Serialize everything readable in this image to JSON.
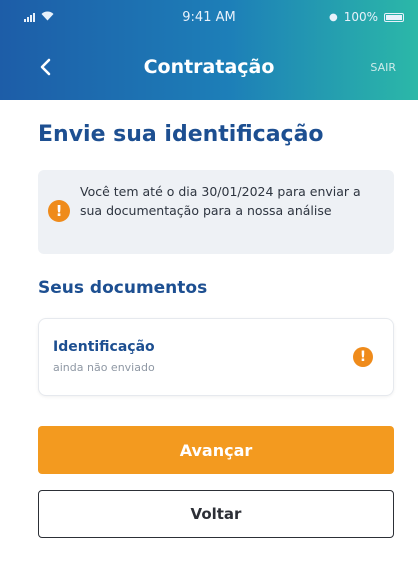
{
  "status_bar": {
    "time": "9:41 AM",
    "battery": "100%",
    "signal_icon": "signal-icon",
    "wifi_icon": "wifi-icon",
    "battery_icon": "battery-icon",
    "alarm_icon": "alarm-icon"
  },
  "nav": {
    "title": "Contratação",
    "exit_label": "SAIR",
    "back_icon": "chevron-left-icon"
  },
  "page": {
    "title": "Envie sua identificação"
  },
  "notice": {
    "text": "Você tem até o dia 30/01/2024 para enviar a sua documentação para a nossa análise",
    "icon": "warning-icon",
    "icon_glyph": "!"
  },
  "documents": {
    "section_title": "Seus documentos",
    "items": [
      {
        "name": "Identificação",
        "status": "ainda não enviado",
        "icon": "warning-icon",
        "icon_glyph": "!"
      }
    ]
  },
  "actions": {
    "next_label": "Avançar",
    "back_label": "Voltar"
  },
  "colors": {
    "brand_blue": "#1d4f91",
    "accent_orange": "#f39a1f",
    "warning_orange": "#ef8b1b",
    "header_gradient_start": "#1d5da8",
    "header_gradient_end": "#2bb8a8"
  }
}
